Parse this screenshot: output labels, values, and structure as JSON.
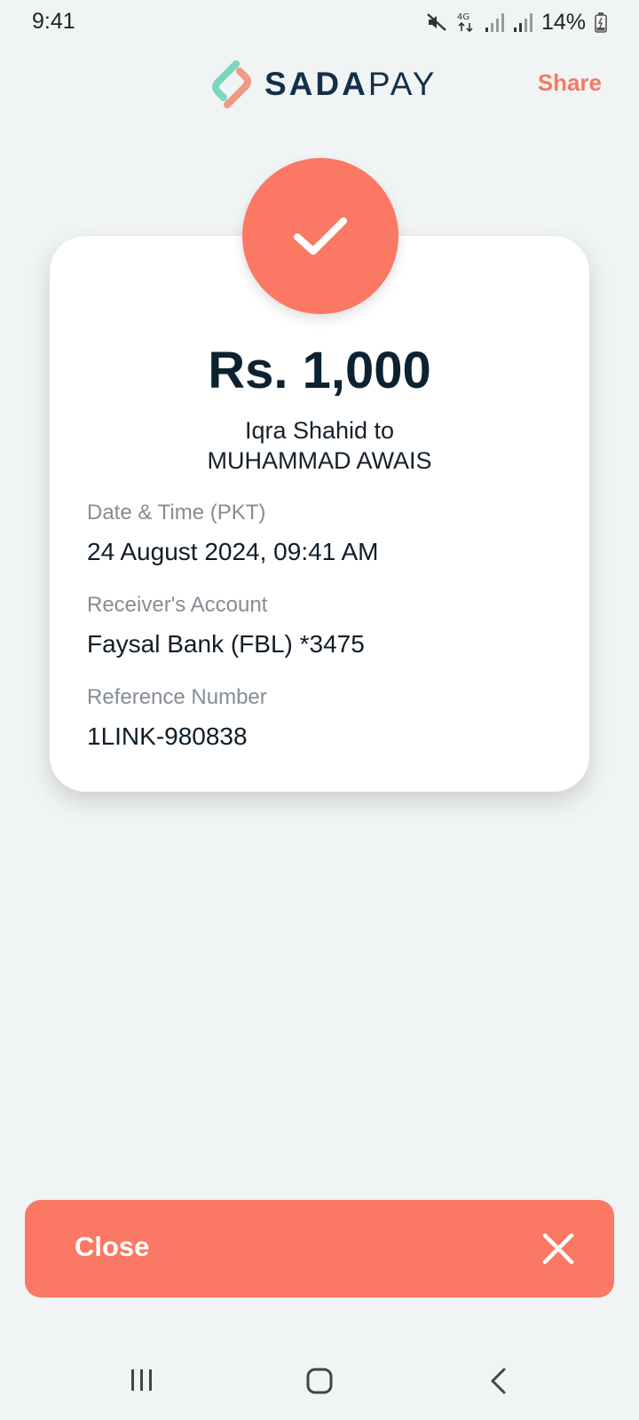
{
  "status_bar": {
    "time": "9:41",
    "battery": "14%",
    "network": "4G",
    "icons": [
      "mute-icon",
      "network-4g-icon",
      "signal-icon",
      "signal-icon",
      "battery-charging-icon"
    ]
  },
  "header": {
    "brand_part1": "SADA",
    "brand_part2": "PAY",
    "share_label": "Share"
  },
  "receipt": {
    "amount": "Rs. 1,000",
    "sender_line": "Iqra Shahid to",
    "receiver_line": "MUHAMMAD AWAIS",
    "date_label": "Date & Time (PKT)",
    "date_value": "24 August 2024, 09:41 AM",
    "account_label": "Receiver's Account",
    "account_value": "Faysal Bank (FBL) *3475",
    "reference_label": "Reference Number",
    "reference_value": "1LINK-980838"
  },
  "footer": {
    "close_label": "Close"
  },
  "colors": {
    "accent": "#fa7864",
    "brand_dark": "#13304a",
    "background": "#f1f4f5",
    "label_gray": "#858d95"
  }
}
